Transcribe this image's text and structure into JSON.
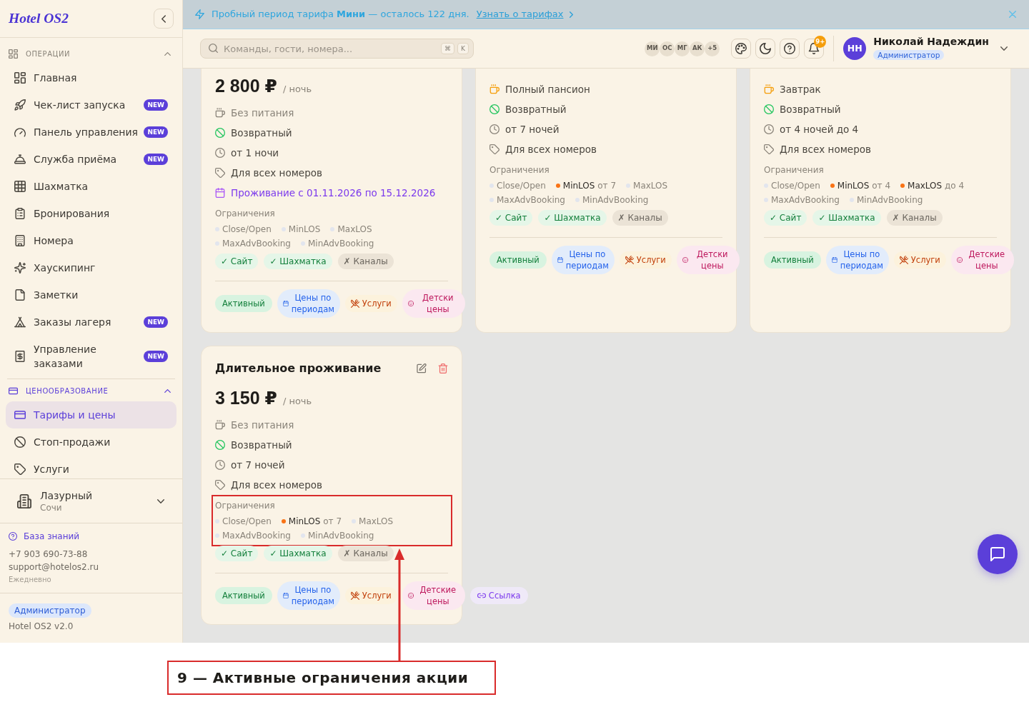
{
  "sidebar": {
    "logo": "Hotel OS2",
    "sections": [
      {
        "title": "ОПЕРАЦИИ",
        "expanded": true,
        "items": [
          {
            "label": "Главная",
            "selected": false
          },
          {
            "label": "Чек-лист запуска",
            "badge": "NEW",
            "selected": false
          },
          {
            "label": "Панель управления",
            "badge": "NEW",
            "selected": false
          },
          {
            "label": "Служба приёма",
            "badge": "NEW",
            "selected": false
          },
          {
            "label": "Шахматка",
            "selected": false
          },
          {
            "label": "Бронирования",
            "selected": false
          },
          {
            "label": "Номера",
            "selected": false
          },
          {
            "label": "Хаускипинг",
            "selected": false
          },
          {
            "label": "Заметки",
            "selected": false
          },
          {
            "label": "Заказы лагеря",
            "badge": "NEW",
            "selected": false
          },
          {
            "label": "Управление заказами",
            "badge": "NEW",
            "selected": false
          }
        ]
      },
      {
        "title": "ЦЕНООБРАЗОВАНИЕ",
        "expanded": true,
        "items": [
          {
            "label": "Тарифы и цены",
            "selected": true
          },
          {
            "label": "Стоп-продажи",
            "selected": false
          },
          {
            "label": "Услуги",
            "selected": false
          }
        ]
      }
    ],
    "property": {
      "name": "Лазурный",
      "city": "Сочи"
    },
    "support": {
      "link": "База знаний",
      "phone": "+7 903 690-73-88",
      "email": "support@hotelos2.ru",
      "hours": "Ежедневно"
    },
    "footer": {
      "role": "Администратор",
      "version": "Hotel OS2 v2.0"
    }
  },
  "banner": {
    "text": "Пробный период тарифа **Мини** — осталось 122 дня.",
    "link": "Узнать о тарифах"
  },
  "topbar": {
    "search": {
      "placeholder": "Команды, гости, номера...",
      "keys": [
        "⌘",
        "K"
      ]
    },
    "team": {
      "members": [
        "МИ",
        "ОС",
        "МГ",
        "АК"
      ],
      "more": "+5"
    },
    "notifications": "9+",
    "user": {
      "initials": "НН",
      "name": "Николай Надеждин",
      "role": "Администратор"
    }
  },
  "cards": [
    {
      "price": "2 800 ₽",
      "unit": "/ ночь",
      "features": [
        {
          "kind": "meal",
          "text": "Без питания",
          "included": false
        },
        {
          "kind": "refund",
          "text": "Возвратный"
        },
        {
          "kind": "stay",
          "text": "от 1 ночи"
        },
        {
          "kind": "rooms",
          "text": "Для всех номеров"
        },
        {
          "kind": "dates",
          "text": "Проживание с 01.11.2026 по 15.12.2026"
        }
      ],
      "restrictions": {
        "label": "Ограничения",
        "highlighted": false,
        "items": [
          {
            "name": "Close/Open",
            "active": false
          },
          {
            "name": "MinLOS",
            "active": false
          },
          {
            "name": "MaxLOS",
            "active": false
          },
          {
            "name": "MaxAdvBooking",
            "active": false
          },
          {
            "name": "MinAdvBooking",
            "active": false
          }
        ]
      },
      "channels": [
        {
          "label": "✓ Сайт",
          "on": true
        },
        {
          "label": "✓ Шахматка",
          "on": true
        },
        {
          "label": "✗ Каналы",
          "on": false
        }
      ],
      "tags": [
        {
          "kind": "status",
          "label": "Активный"
        },
        {
          "kind": "periods",
          "label": "Цены по периодам"
        },
        {
          "kind": "services",
          "label": "Услуги"
        },
        {
          "kind": "kids",
          "label": "Детски цены"
        }
      ]
    },
    {
      "features": [
        {
          "kind": "meal",
          "text": "Полный пансион",
          "included": true
        },
        {
          "kind": "refund",
          "text": "Возвратный"
        },
        {
          "kind": "stay",
          "text": "от 7 ночей"
        },
        {
          "kind": "rooms",
          "text": "Для всех номеров"
        }
      ],
      "restrictions": {
        "label": "Ограничения",
        "highlighted": false,
        "items": [
          {
            "name": "Close/Open",
            "active": false
          },
          {
            "name": "MinLOS",
            "value": "от 7",
            "active": true
          },
          {
            "name": "MaxLOS",
            "active": false
          },
          {
            "name": "MaxAdvBooking",
            "active": false
          },
          {
            "name": "MinAdvBooking",
            "active": false
          }
        ]
      },
      "channels": [
        {
          "label": "✓ Сайт",
          "on": true
        },
        {
          "label": "✓ Шахматка",
          "on": true
        },
        {
          "label": "✗ Каналы",
          "on": false
        }
      ],
      "tags": [
        {
          "kind": "status",
          "label": "Активный"
        },
        {
          "kind": "periods",
          "label": "Цены по периодам"
        },
        {
          "kind": "services",
          "label": "Услуги"
        },
        {
          "kind": "kids",
          "label": "Детски цены"
        }
      ]
    },
    {
      "features": [
        {
          "kind": "meal",
          "text": "Завтрак",
          "included": true
        },
        {
          "kind": "refund",
          "text": "Возвратный"
        },
        {
          "kind": "stay",
          "text": "от 4 ночей до 4"
        },
        {
          "kind": "rooms",
          "text": "Для всех номеров"
        }
      ],
      "restrictions": {
        "label": "Ограничения",
        "highlighted": false,
        "items": [
          {
            "name": "Close/Open",
            "active": false
          },
          {
            "name": "MinLOS",
            "value": "от 4",
            "active": true
          },
          {
            "name": "MaxLOS",
            "value": "до 4",
            "active": true
          },
          {
            "name": "MaxAdvBooking",
            "active": false
          },
          {
            "name": "MinAdvBooking",
            "active": false
          }
        ]
      },
      "channels": [
        {
          "label": "✓ Сайт",
          "on": true
        },
        {
          "label": "✓ Шахматка",
          "on": true
        },
        {
          "label": "✗ Каналы",
          "on": false
        }
      ],
      "tags": [
        {
          "kind": "status",
          "label": "Активный"
        },
        {
          "kind": "periods",
          "label": "Цены по периодам"
        },
        {
          "kind": "services",
          "label": "Услуги"
        },
        {
          "kind": "kids",
          "label": "Детские цены"
        }
      ]
    },
    {
      "title": "Длительное проживание",
      "price": "3 150 ₽",
      "unit": "/ ночь",
      "features": [
        {
          "kind": "meal",
          "text": "Без питания",
          "included": false
        },
        {
          "kind": "refund",
          "text": "Возвратный"
        },
        {
          "kind": "stay",
          "text": "от 7 ночей"
        },
        {
          "kind": "rooms",
          "text": "Для всех номеров"
        }
      ],
      "restrictions": {
        "label": "Ограничения",
        "highlighted": true,
        "items": [
          {
            "name": "Close/Open",
            "active": false
          },
          {
            "name": "MinLOS",
            "value": "от 7",
            "active": true
          },
          {
            "name": "MaxLOS",
            "active": false
          },
          {
            "name": "MaxAdvBooking",
            "active": false
          },
          {
            "name": "MinAdvBooking",
            "active": false
          }
        ]
      },
      "channels": [
        {
          "label": "✓ Сайт",
          "on": true
        },
        {
          "label": "✓ Шахматка",
          "on": true
        },
        {
          "label": "✗ Каналы",
          "on": false
        }
      ],
      "tags": [
        {
          "kind": "status",
          "label": "Активный"
        },
        {
          "kind": "periods",
          "label": "Цены по периодам"
        },
        {
          "kind": "services",
          "label": "Услуги"
        },
        {
          "kind": "kids",
          "label": "Детские цены"
        },
        {
          "kind": "link",
          "label": "Ссылка"
        }
      ]
    }
  ],
  "annotation": {
    "label": "9 — Активные ограничения акции"
  }
}
